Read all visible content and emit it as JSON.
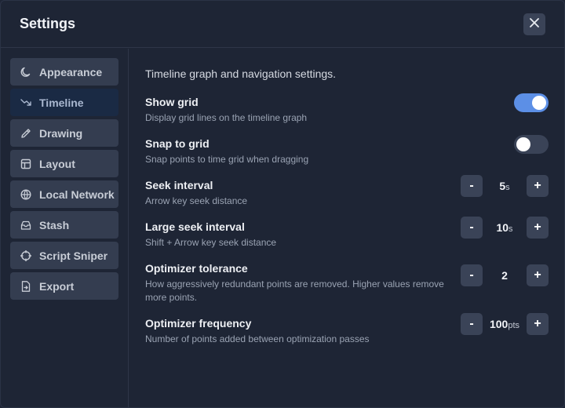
{
  "header": {
    "title": "Settings"
  },
  "sidebar": {
    "items": [
      {
        "label": "Appearance",
        "icon": "moon-icon"
      },
      {
        "label": "Timeline",
        "icon": "trending-down-icon",
        "active": true
      },
      {
        "label": "Drawing",
        "icon": "pencil-icon"
      },
      {
        "label": "Layout",
        "icon": "layout-icon"
      },
      {
        "label": "Local Network",
        "icon": "globe-icon"
      },
      {
        "label": "Stash",
        "icon": "archive-icon"
      },
      {
        "label": "Script Sniper",
        "icon": "crosshair-icon"
      },
      {
        "label": "Export",
        "icon": "file-export-icon"
      }
    ]
  },
  "main": {
    "intro": "Timeline graph and navigation settings.",
    "settings": [
      {
        "label": "Show grid",
        "desc": "Display grid lines on the timeline graph",
        "type": "toggle",
        "on": true
      },
      {
        "label": "Snap to grid",
        "desc": "Snap points to time grid when dragging",
        "type": "toggle",
        "on": false
      },
      {
        "label": "Seek interval",
        "desc": "Arrow key seek distance",
        "type": "stepper",
        "value": "5",
        "unit": "s"
      },
      {
        "label": "Large seek interval",
        "desc": "Shift + Arrow key seek distance",
        "type": "stepper",
        "value": "10",
        "unit": "s"
      },
      {
        "label": "Optimizer tolerance",
        "desc": "How aggressively redundant points are removed. Higher values remove more points.",
        "type": "stepper",
        "value": "2",
        "unit": ""
      },
      {
        "label": "Optimizer frequency",
        "desc": "Number of points added between optimization passes",
        "type": "stepper",
        "value": "100",
        "unit": "pts"
      }
    ],
    "stepper": {
      "minus": "-",
      "plus": "+"
    }
  },
  "colors": {
    "accent": "#5c8fe6",
    "background": "#1e2535",
    "button": "#3a4357"
  }
}
